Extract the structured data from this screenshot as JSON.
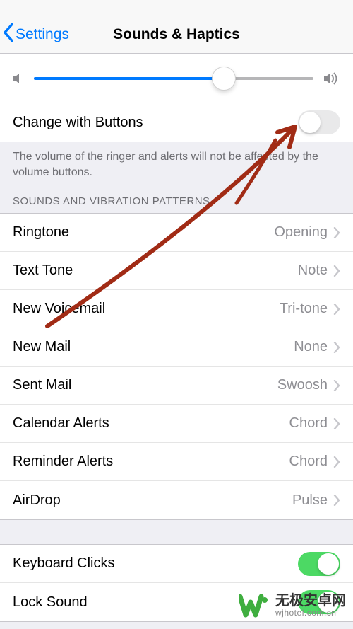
{
  "nav": {
    "back": "Settings",
    "title": "Sounds & Haptics"
  },
  "slider": {
    "value": 68
  },
  "changeWithButtons": {
    "label": "Change with Buttons",
    "on": false
  },
  "footerNote": "The volume of the ringer and alerts will not be affected by the volume buttons.",
  "soundsHeader": "SOUNDS AND VIBRATION PATTERNS",
  "sounds": [
    {
      "label": "Ringtone",
      "value": "Opening"
    },
    {
      "label": "Text Tone",
      "value": "Note"
    },
    {
      "label": "New Voicemail",
      "value": "Tri-tone"
    },
    {
      "label": "New Mail",
      "value": "None"
    },
    {
      "label": "Sent Mail",
      "value": "Swoosh"
    },
    {
      "label": "Calendar Alerts",
      "value": "Chord"
    },
    {
      "label": "Reminder Alerts",
      "value": "Chord"
    },
    {
      "label": "AirDrop",
      "value": "Pulse"
    }
  ],
  "systemSounds": [
    {
      "label": "Keyboard Clicks",
      "on": true
    },
    {
      "label": "Lock Sound",
      "on": true
    }
  ],
  "watermark": {
    "main": "无极安卓网",
    "sub": "wjhotel.com.cn"
  }
}
